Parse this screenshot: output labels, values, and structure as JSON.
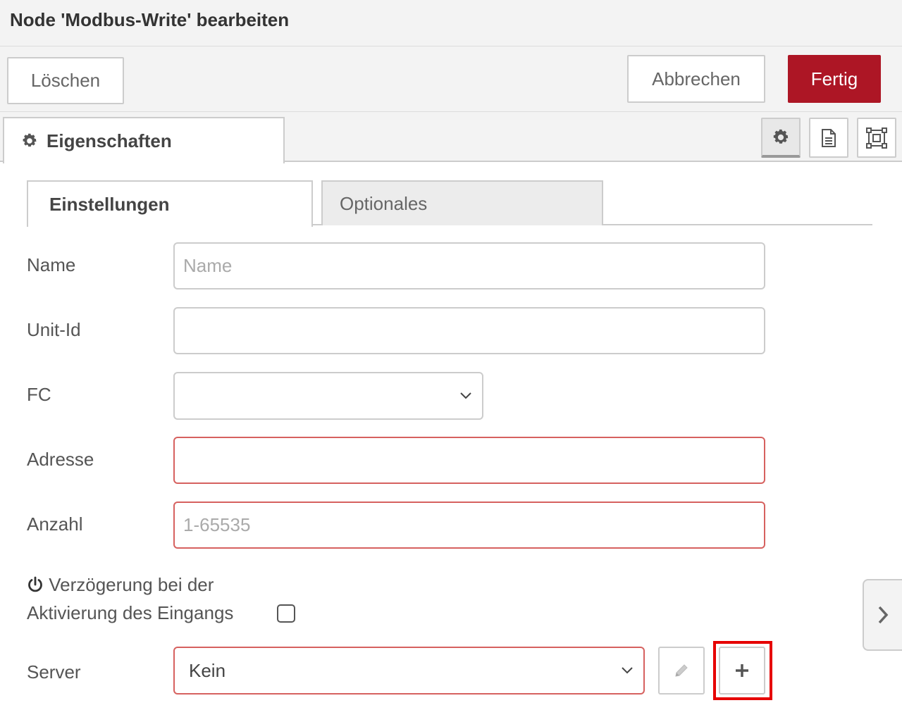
{
  "dialog": {
    "title": "Node 'Modbus-Write' bearbeiten"
  },
  "toolbar": {
    "delete_label": "Löschen",
    "cancel_label": "Abbrechen",
    "done_label": "Fertig",
    "done_color": "#ad1625"
  },
  "tabs": {
    "properties_label": "Eigenschaften",
    "properties_icon": "gear-icon",
    "tool_icons": [
      "gear-icon",
      "document-icon",
      "node-appearance-icon"
    ]
  },
  "subtabs": [
    {
      "label": "Einstellungen",
      "active": true
    },
    {
      "label": "Optionales",
      "active": false
    }
  ],
  "form": {
    "name": {
      "label": "Name",
      "value": "",
      "placeholder": "Name"
    },
    "unit_id": {
      "label": "Unit-Id",
      "value": "",
      "placeholder": ""
    },
    "fc": {
      "label": "FC",
      "value": ""
    },
    "adresse": {
      "label": "Adresse",
      "value": "",
      "placeholder": "",
      "invalid": true
    },
    "anzahl": {
      "label": "Anzahl",
      "value": "",
      "placeholder": "1-65535",
      "invalid": true
    },
    "delay": {
      "label": "Verzögerung bei der Aktivierung des Eingangs",
      "line1": "Verzögerung bei der",
      "line2": "Aktivierung des Eingangs",
      "icon": "power-icon",
      "checked": false
    },
    "server": {
      "label": "Server",
      "value": "Kein",
      "invalid": true
    }
  },
  "colors": {
    "invalid_border": "#d6615f",
    "highlight": "#e60000"
  }
}
